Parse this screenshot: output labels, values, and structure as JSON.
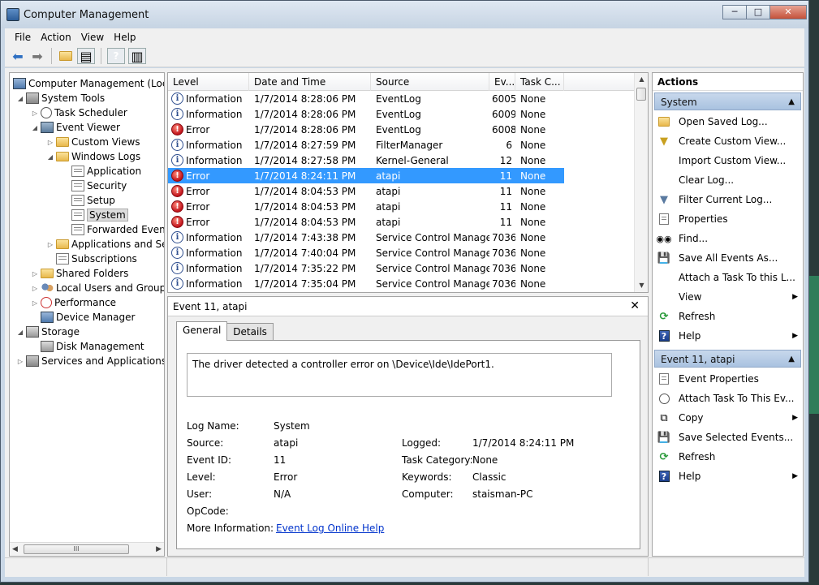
{
  "window": {
    "title": "Computer Management"
  },
  "menu": [
    "File",
    "Action",
    "View",
    "Help"
  ],
  "tree": {
    "root": "Computer Management (Local",
    "system_tools": "System Tools",
    "task_scheduler": "Task Scheduler",
    "event_viewer": "Event Viewer",
    "custom_views": "Custom Views",
    "windows_logs": "Windows Logs",
    "application": "Application",
    "security": "Security",
    "setup": "Setup",
    "system": "System",
    "forwarded_events": "Forwarded Event",
    "applications_and_services": "Applications and Se",
    "subscriptions": "Subscriptions",
    "shared_folders": "Shared Folders",
    "local_users": "Local Users and Groups",
    "performance": "Performance",
    "device_manager": "Device Manager",
    "storage": "Storage",
    "disk_management": "Disk Management",
    "services_and_applications": "Services and Applications",
    "hscroll_thumb": "III"
  },
  "events": {
    "columns": [
      "Level",
      "Date and Time",
      "Source",
      "Ev...",
      "Task C..."
    ],
    "rows": [
      {
        "level": "Information",
        "type": "info",
        "date": "1/7/2014 8:28:06 PM",
        "source": "EventLog",
        "id": "6005",
        "task": "None"
      },
      {
        "level": "Information",
        "type": "info",
        "date": "1/7/2014 8:28:06 PM",
        "source": "EventLog",
        "id": "6009",
        "task": "None"
      },
      {
        "level": "Error",
        "type": "err",
        "date": "1/7/2014 8:28:06 PM",
        "source": "EventLog",
        "id": "6008",
        "task": "None"
      },
      {
        "level": "Information",
        "type": "info",
        "date": "1/7/2014 8:27:59 PM",
        "source": "FilterManager",
        "id": "6",
        "task": "None"
      },
      {
        "level": "Information",
        "type": "info",
        "date": "1/7/2014 8:27:58 PM",
        "source": "Kernel-General",
        "id": "12",
        "task": "None"
      },
      {
        "level": "Error",
        "type": "err",
        "date": "1/7/2014 8:24:11 PM",
        "source": "atapi",
        "id": "11",
        "task": "None",
        "selected": true
      },
      {
        "level": "Error",
        "type": "err",
        "date": "1/7/2014 8:04:53 PM",
        "source": "atapi",
        "id": "11",
        "task": "None"
      },
      {
        "level": "Error",
        "type": "err",
        "date": "1/7/2014 8:04:53 PM",
        "source": "atapi",
        "id": "11",
        "task": "None"
      },
      {
        "level": "Error",
        "type": "err",
        "date": "1/7/2014 8:04:53 PM",
        "source": "atapi",
        "id": "11",
        "task": "None"
      },
      {
        "level": "Information",
        "type": "info",
        "date": "1/7/2014 7:43:38 PM",
        "source": "Service Control Manager",
        "id": "7036",
        "task": "None"
      },
      {
        "level": "Information",
        "type": "info",
        "date": "1/7/2014 7:40:04 PM",
        "source": "Service Control Manager",
        "id": "7036",
        "task": "None"
      },
      {
        "level": "Information",
        "type": "info",
        "date": "1/7/2014 7:35:22 PM",
        "source": "Service Control Manager",
        "id": "7036",
        "task": "None"
      },
      {
        "level": "Information",
        "type": "info",
        "date": "1/7/2014 7:35:04 PM",
        "source": "Service Control Manager",
        "id": "7036",
        "task": "None"
      }
    ]
  },
  "details": {
    "title": "Event 11, atapi",
    "tabs": [
      "General",
      "Details"
    ],
    "description": "The driver detected a controller error on \\Device\\Ide\\IdePort1.",
    "log_name_label": "Log Name:",
    "log_name": "System",
    "source_label": "Source:",
    "source": "atapi",
    "logged_label": "Logged:",
    "logged": "1/7/2014 8:24:11 PM",
    "event_id_label": "Event ID:",
    "event_id": "11",
    "task_category_label": "Task Category:",
    "task_category": "None",
    "level_label": "Level:",
    "level": "Error",
    "keywords_label": "Keywords:",
    "keywords": "Classic",
    "user_label": "User:",
    "user": "N/A",
    "computer_label": "Computer:",
    "computer": "staisman-PC",
    "opcode_label": "OpCode:",
    "more_info_label": "More Information:",
    "more_info_link": "Event Log Online Help"
  },
  "actions": {
    "header": "Actions",
    "section1": "System",
    "items1": [
      "Open Saved Log...",
      "Create Custom View...",
      "Import Custom View...",
      "Clear Log...",
      "Filter Current Log...",
      "Properties",
      "Find...",
      "Save All Events As...",
      "Attach a Task To this L...",
      "View",
      "Refresh",
      "Help"
    ],
    "section2": "Event 11, atapi",
    "items2": [
      "Event Properties",
      "Attach Task To This Ev...",
      "Copy",
      "Save Selected Events...",
      "Refresh",
      "Help"
    ]
  }
}
